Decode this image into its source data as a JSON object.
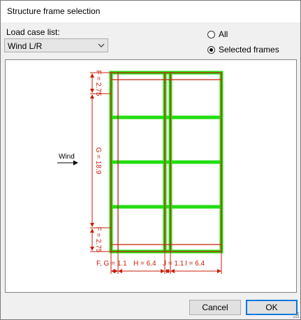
{
  "window": {
    "title": "Structure frame selection"
  },
  "load_case": {
    "label": "Load case list:",
    "value": "Wind L/R"
  },
  "radios": {
    "all": {
      "label": "All",
      "selected": false
    },
    "selected_frames": {
      "label": "Selected frames",
      "selected": true
    }
  },
  "drawing": {
    "wind_label": "Wind",
    "dim_f_top": "F = 2.75",
    "dim_g": "G = 18.9",
    "dim_f_bottom": "F = 2.75",
    "dim_fg": "F, G = 1.1",
    "dim_h": "H = 6.4",
    "dim_j": "J = 1.1",
    "dim_i": "I = 6.4",
    "frame_color": "#22dd11",
    "dimension_color": "#c81e0a"
  },
  "buttons": {
    "cancel": "Cancel",
    "ok": "OK"
  }
}
